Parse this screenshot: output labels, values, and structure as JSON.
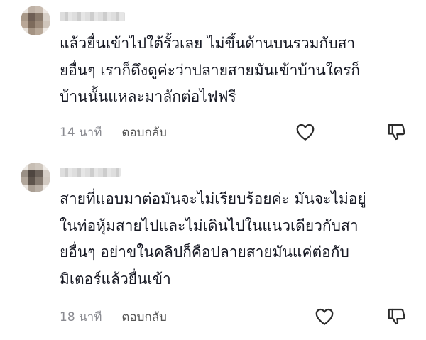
{
  "comments": [
    {
      "username": "",
      "text": "แล้วยื่นเข้าไปใต้รั้วเลย ไม่ขึ้นด้านบนรวมกับสา\nยอื่นๆ เราก็ดึงดูค่ะว่าปลายสายมันเข้าบ้านใครก็\nบ้านนั้นแหละมาลักต่อไฟฟรี",
      "time": "14 นาที",
      "reply_label": "ตอบกลับ",
      "like_icon": "heart-outline-icon",
      "dislike_icon": "thumbs-down-outline-icon"
    },
    {
      "username": "",
      "text": "สายที่แอบมาต่อมันจะไม่เรียบร้อยค่ะ มันจะไม่อยู่\nในท่อหุ้มสายไปและไม่เดินไปในแนวเดียวกับสา\nยอื่นๆ อย่าขในคลิปก็คือปลายสายมันแค่ต่อกับ\nมิเตอร์แล้วยื่นเข้า",
      "time": "18 นาที",
      "reply_label": "ตอบกลับ",
      "like_icon": "heart-outline-icon",
      "dislike_icon": "thumbs-down-outline-icon"
    }
  ],
  "colors": {
    "text": "#161823",
    "meta": "#8a8b91",
    "icon": "#2b2b2b"
  }
}
